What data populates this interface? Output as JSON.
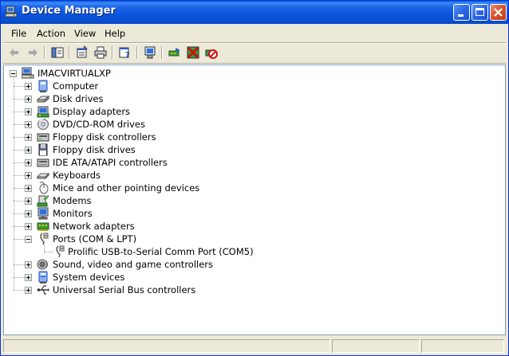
{
  "window": {
    "title": "Device Manager"
  },
  "menu": [
    "File",
    "Action",
    "View",
    "Help"
  ],
  "tree": {
    "root": "IMACVIRTUALXP",
    "categories": [
      {
        "label": "Computer",
        "icon": "computer-icon"
      },
      {
        "label": "Disk drives",
        "icon": "disk-drive-icon"
      },
      {
        "label": "Display adapters",
        "icon": "display-adapter-icon"
      },
      {
        "label": "DVD/CD-ROM drives",
        "icon": "dvd-drive-icon"
      },
      {
        "label": "Floppy disk controllers",
        "icon": "floppy-controller-icon"
      },
      {
        "label": "Floppy disk drives",
        "icon": "floppy-drive-icon"
      },
      {
        "label": "IDE ATA/ATAPI controllers",
        "icon": "ide-controller-icon"
      },
      {
        "label": "Keyboards",
        "icon": "keyboard-icon"
      },
      {
        "label": "Mice and other pointing devices",
        "icon": "mouse-icon"
      },
      {
        "label": "Modems",
        "icon": "modem-icon"
      },
      {
        "label": "Monitors",
        "icon": "monitor-icon"
      },
      {
        "label": "Network adapters",
        "icon": "network-adapter-icon"
      },
      {
        "label": "Ports (COM & LPT)",
        "icon": "port-icon",
        "expanded": true,
        "children": [
          {
            "label": "Prolific USB-to-Serial Comm Port (COM5)",
            "icon": "port-icon"
          }
        ]
      },
      {
        "label": "Sound, video and game controllers",
        "icon": "sound-icon"
      },
      {
        "label": "System devices",
        "icon": "system-device-icon"
      },
      {
        "label": "Universal Serial Bus controllers",
        "icon": "usb-icon"
      }
    ]
  },
  "colors": {
    "title_bar": "#0A55DC",
    "window_bg": "#ECE9D8",
    "content_bg": "#FFFFFF"
  }
}
